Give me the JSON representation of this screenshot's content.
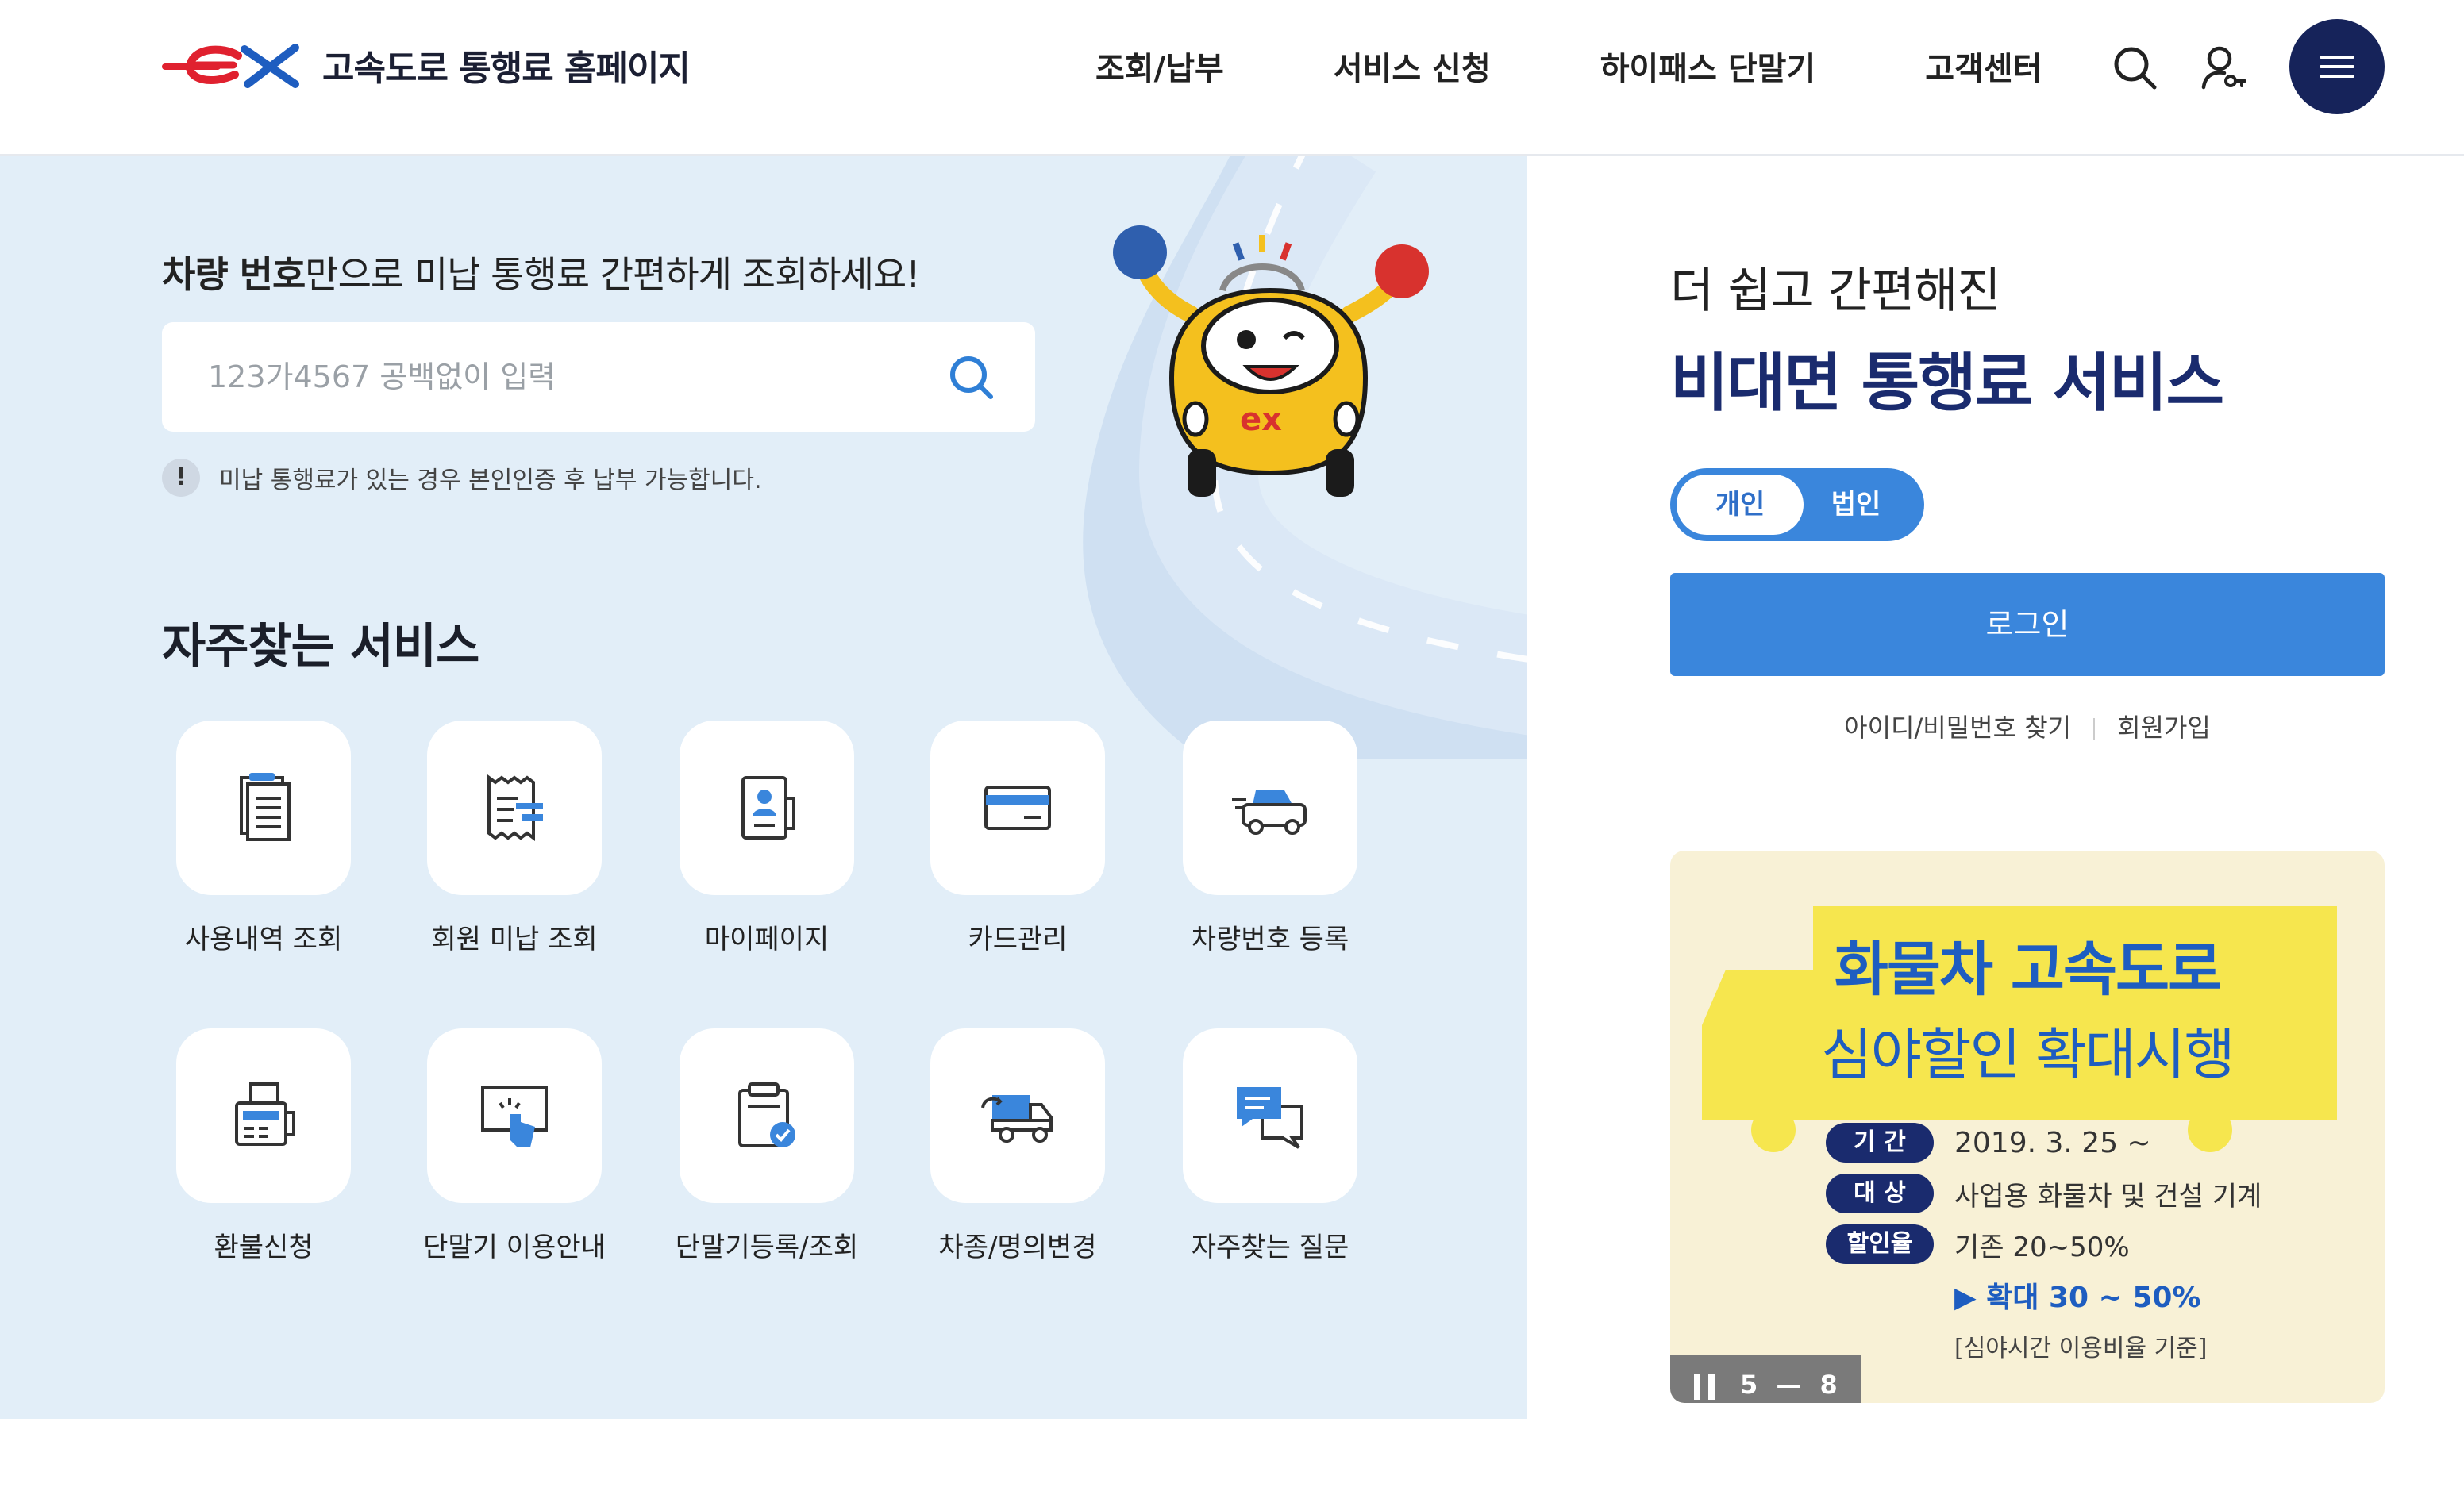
{
  "header": {
    "logo_mark": "ex",
    "site_title": "고속도로 통행료 홈페이지",
    "nav": [
      {
        "label": "조회/납부"
      },
      {
        "label": "서비스 신청"
      },
      {
        "label": "하이패스 단말기"
      },
      {
        "label": "고객센터"
      }
    ],
    "icons": {
      "search": "search-icon",
      "user": "user-key-icon",
      "menu": "hamburger-menu-icon"
    }
  },
  "vehicle_search": {
    "heading_bold": "차량 번호",
    "heading_rest": "만으로 미납 통행료 간편하게 조회하세요!",
    "placeholder": "123가4567 공백없이 입력",
    "notice_icon": "!",
    "notice": "미납 통행료가 있는 경우 본인인증 후 납부 가능합니다."
  },
  "frequent_services": {
    "title": "자주찾는 서비스",
    "items": [
      {
        "label": "사용내역 조회",
        "icon": "document-list-icon"
      },
      {
        "label": "회원 미납 조회",
        "icon": "receipt-icon"
      },
      {
        "label": "마이페이지",
        "icon": "profile-card-icon"
      },
      {
        "label": "카드관리",
        "icon": "credit-card-icon"
      },
      {
        "label": "차량번호 등록",
        "icon": "car-register-icon"
      },
      {
        "label": "환불신청",
        "icon": "refund-machine-icon"
      },
      {
        "label": "단말기 이용안내",
        "icon": "touch-screen-icon"
      },
      {
        "label": "단말기등록/조회",
        "icon": "clipboard-check-icon"
      },
      {
        "label": "차종/명의변경",
        "icon": "truck-change-icon"
      },
      {
        "label": "자주찾는 질문",
        "icon": "chat-bubbles-icon"
      }
    ]
  },
  "login_panel": {
    "line1": "더 쉽고 간편해진",
    "line2": "비대면 통행료 서비스",
    "toggle": {
      "personal": "개인",
      "corporate": "법인",
      "selected": "개인"
    },
    "login_label": "로그인",
    "find_account": "아이디/비밀번호 찾기",
    "signup": "회원가입"
  },
  "banner": {
    "title_line1": "화물차 고속도로",
    "title_line2": "심야할인 확대시행",
    "rows": [
      {
        "badge": "기  간",
        "text": "2019. 3. 25 ~"
      },
      {
        "badge": "대  상",
        "text": "사업용 화물차 및 건설 기계"
      },
      {
        "badge": "할인율",
        "text": "기존 20~50%"
      }
    ],
    "highlight": "▶ 확대 30 ~ 50%",
    "note": "[심야시간 이용비율 기준]",
    "slide_current": "5",
    "slide_separator": "—",
    "slide_total": "8"
  },
  "colors": {
    "brand_navy": "#16235a",
    "accent_blue": "#3a86dc",
    "left_bg": "#e2eef8",
    "banner_bg": "#f8f1d6",
    "logo_red": "#e0212f"
  }
}
